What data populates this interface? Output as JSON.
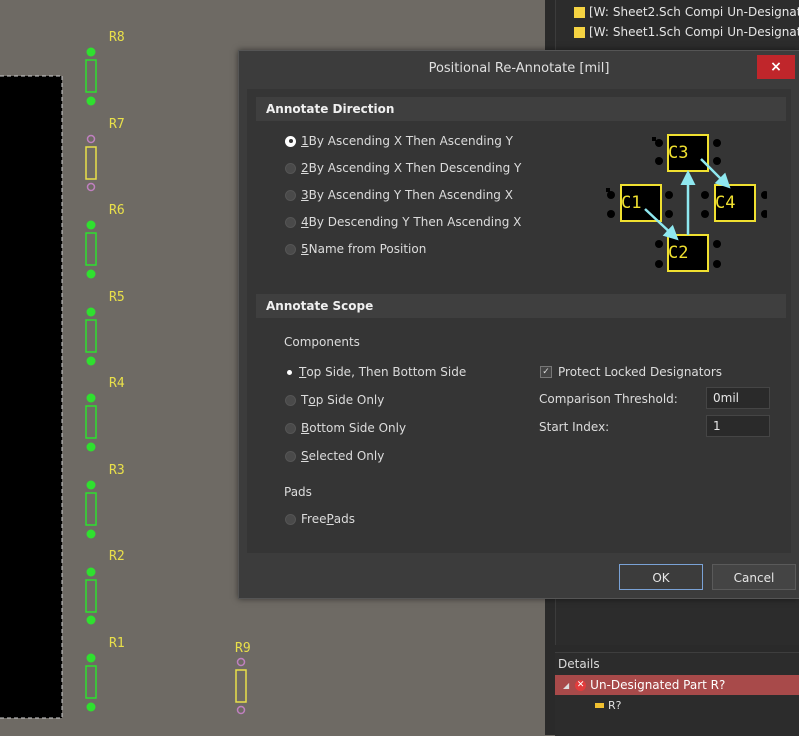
{
  "pcb": {
    "designators": [
      "R8",
      "R7",
      "R6",
      "R5",
      "R4",
      "R3",
      "R2",
      "R1",
      "R9"
    ]
  },
  "messages_panel": {
    "rows": [
      {
        "col1": "[W:",
        "col2": "Sheet2.Sch",
        "col3": "Compi",
        "col4": "Un-Designated I"
      },
      {
        "col1": "[W:",
        "col2": "Sheet1.Sch",
        "col3": "Compi",
        "col4": "Un-Designated I"
      }
    ]
  },
  "details": {
    "header": "Details",
    "error_text": "Un-Designated Part R?",
    "sub_item": "R?"
  },
  "dialog": {
    "title": "Positional Re-Annotate [mil]",
    "close_label": "×",
    "direction": {
      "header": "Annotate Direction",
      "options": [
        {
          "key": "1",
          "rest": " By Ascending X Then Ascending Y",
          "selected": true
        },
        {
          "key": "2",
          "rest": " By Ascending X Then Descending Y",
          "selected": false
        },
        {
          "key": "3",
          "rest": " By Ascending Y Then Ascending X",
          "selected": false
        },
        {
          "key": "4",
          "rest": " By Descending Y Then Ascending X",
          "selected": false
        },
        {
          "key": "5",
          "rest": " Name from Position",
          "selected": false
        }
      ],
      "preview_labels": [
        "C3",
        "C1",
        "C4",
        "C2"
      ]
    },
    "scope": {
      "header": "Annotate Scope",
      "components_label": "Components",
      "component_options": [
        {
          "key": "T",
          "rest": "op Side, Then Bottom Side",
          "selected": true
        },
        {
          "pre": "T",
          "key": "o",
          "rest": "p Side Only",
          "selected": false
        },
        {
          "key": "B",
          "rest": "ottom Side Only",
          "selected": false
        },
        {
          "key": "S",
          "rest": "elected Only",
          "selected": false
        }
      ],
      "pads_label": "Pads",
      "pad_option": {
        "pre": "Free ",
        "key": "P",
        "rest": "ads",
        "selected": false
      },
      "protect_locked_label": "Protect Locked Designators",
      "protect_locked_checked": true,
      "threshold_label": "Comparison Threshold:",
      "threshold_value": "0mil",
      "start_index_label": "Start Index:",
      "start_index_value": "1"
    },
    "ok_label": "OK",
    "cancel_label": "Cancel"
  }
}
